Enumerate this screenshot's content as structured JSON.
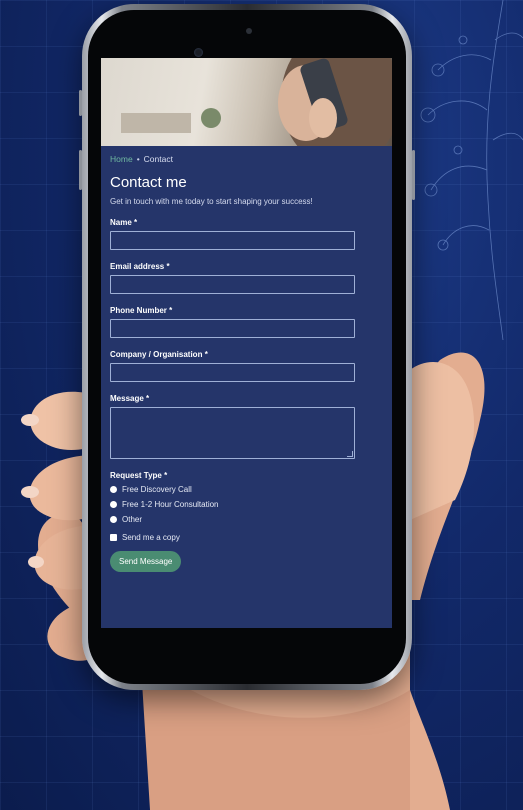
{
  "breadcrumb": {
    "home": "Home",
    "separator": "•",
    "current": "Contact"
  },
  "page": {
    "title": "Contact me",
    "subtitle": "Get in touch with me today to start shaping your success!"
  },
  "form": {
    "name_label": "Name",
    "email_label": "Email address",
    "phone_label": "Phone Number",
    "company_label": "Company / Organisation",
    "message_label": "Message",
    "required_marker": "*",
    "name_value": "",
    "email_value": "",
    "phone_value": "",
    "company_value": "",
    "message_value": "",
    "request_type_label": "Request Type",
    "request_options": [
      "Free Discovery Call",
      "Free 1-2 Hour Consultation",
      "Other"
    ],
    "copy_label": "Send me a copy",
    "submit_label": "Send Message"
  },
  "colors": {
    "screen_bg": "#25356a",
    "accent_green": "#4a8c72",
    "breadcrumb_link": "#6fb7a0",
    "page_bg": "#12296a"
  }
}
